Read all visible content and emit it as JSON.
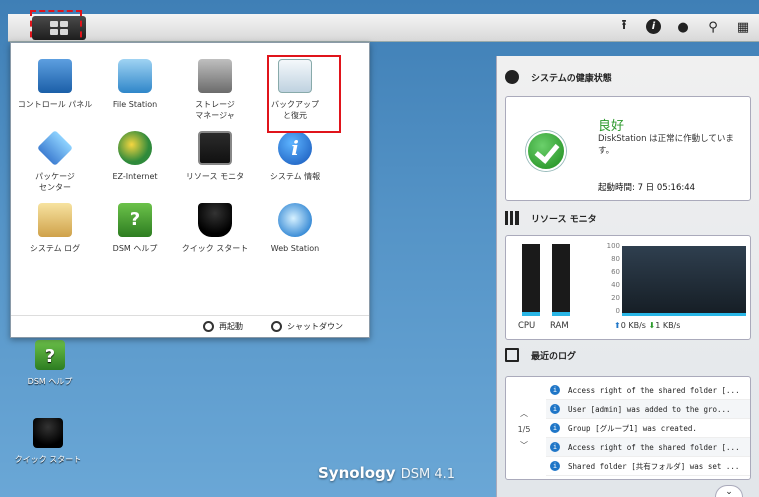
{
  "taskbar": {
    "icons": [
      "upload-icon",
      "info-icon",
      "user-icon",
      "search-icon",
      "widgets-icon"
    ]
  },
  "apps": [
    {
      "label": "コントロール パネル",
      "icon": "control-panel-icon"
    },
    {
      "label": "File Station",
      "icon": "file-station-icon"
    },
    {
      "label": "ストレージ\nマネージャ",
      "icon": "storage-manager-icon"
    },
    {
      "label": "バックアップ\nと復元",
      "icon": "backup-restore-icon"
    },
    {
      "label": "パッケージ\nセンター",
      "icon": "package-center-icon"
    },
    {
      "label": "EZ-Internet",
      "icon": "ez-internet-icon"
    },
    {
      "label": "リソース モニタ",
      "icon": "resource-monitor-icon"
    },
    {
      "label": "システム 情報",
      "icon": "system-info-icon"
    },
    {
      "label": "システム ログ",
      "icon": "system-log-icon"
    },
    {
      "label": "DSM ヘルプ",
      "icon": "dsm-help-icon"
    },
    {
      "label": "クイック スタート",
      "icon": "quick-start-icon"
    },
    {
      "label": "Web Station",
      "icon": "web-station-icon"
    }
  ],
  "menu_footer": {
    "restart": "再起動",
    "shutdown": "シャットダウン"
  },
  "desktop": {
    "help": "DSM ヘルプ",
    "quick_start": "クイック スタート"
  },
  "brand": {
    "name": "Synology",
    "product": "DSM 4.1"
  },
  "health": {
    "title": "システムの健康状態",
    "status": "良好",
    "description": "DiskStation は正常に作動しています。",
    "uptime": "起動時間: 7 日 05:16:44"
  },
  "resource": {
    "title": "リソース モニタ",
    "cpu_label": "CPU",
    "ram_label": "RAM",
    "y_ticks": [
      "100",
      "80",
      "60",
      "40",
      "20",
      "0"
    ],
    "upload": "0 KB/s",
    "download": "1 KB/s"
  },
  "logs": {
    "title": "最近のログ",
    "page": "1/5",
    "entries": [
      "Access right of the shared folder [...",
      "User [admin] was added to the gro...",
      "Group [グループ1] was created.",
      "Access right of the shared folder [...",
      "Shared folder [共有フォルダ] was set ..."
    ]
  },
  "colors": {
    "highlight": "#e0141b",
    "health_ok": "#2d9a2d",
    "accent_blue": "#29b6e6"
  }
}
